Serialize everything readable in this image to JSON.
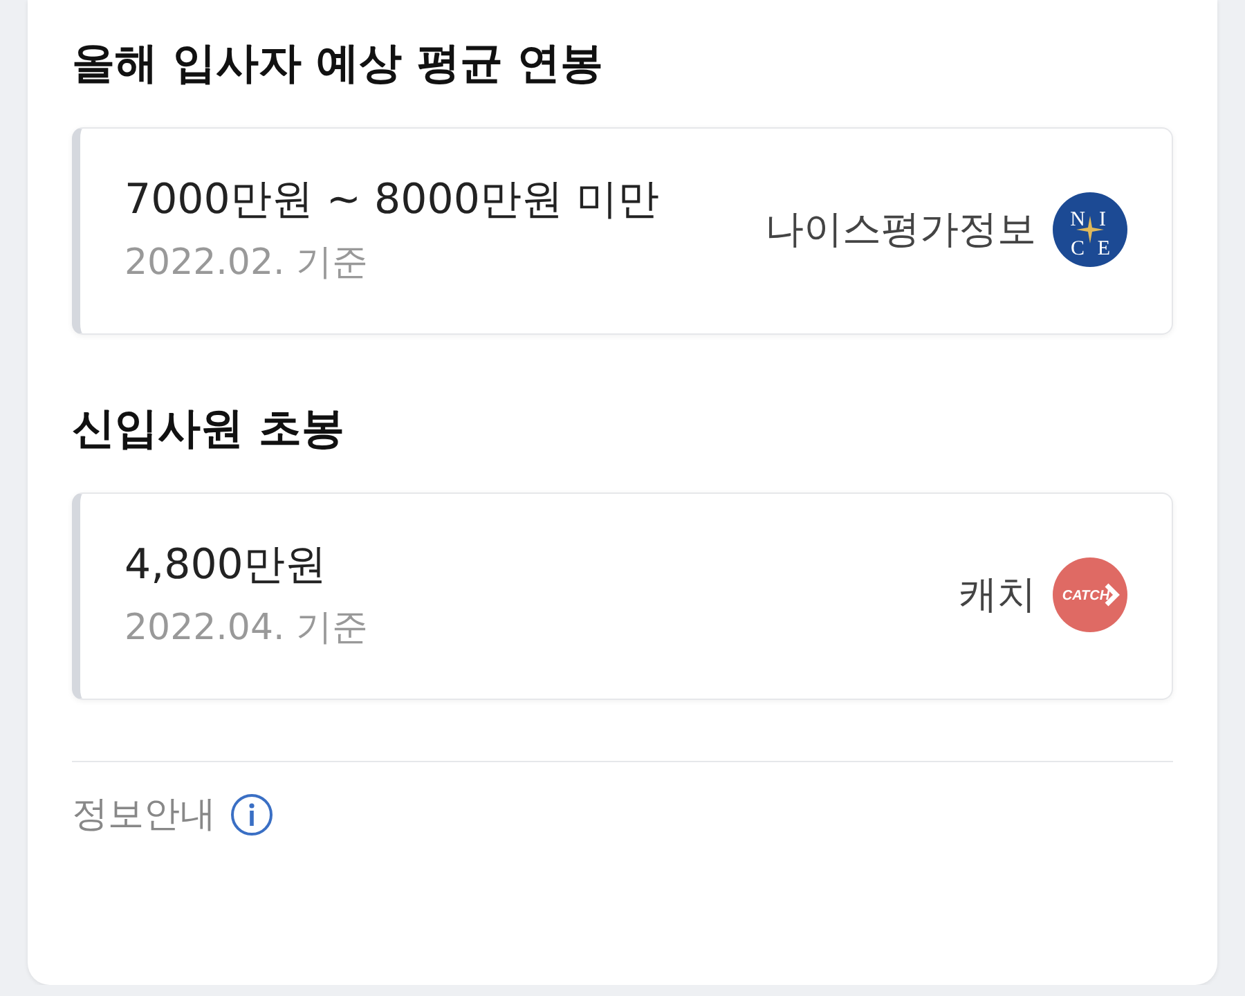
{
  "sections": [
    {
      "title": "올해 입사자 예상 평균 연봉",
      "amount": "7000만원 ~ 8000만원 미만",
      "basis": "2022.02. 기준",
      "source": "나이스평가정보",
      "logo": {
        "kind": "nice",
        "letters": [
          "N",
          "I",
          "C",
          "E"
        ]
      }
    },
    {
      "title": "신입사원 초봉",
      "amount": "4,800만원",
      "basis": "2022.04. 기준",
      "source": "캐치",
      "logo": {
        "kind": "catch",
        "text": "CATCH"
      }
    }
  ],
  "footer": {
    "label": "정보안내"
  }
}
